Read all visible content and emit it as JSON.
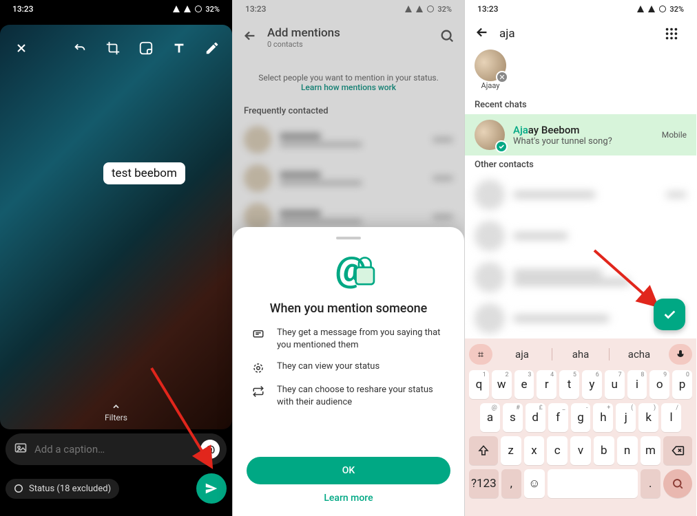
{
  "statusbar": {
    "time": "13:23",
    "battery": "32%"
  },
  "pane1": {
    "sticker_text": "test beebom",
    "filters_label": "Filters",
    "caption_placeholder": "Add a caption…",
    "audience": "Status (18 excluded)"
  },
  "pane2": {
    "title": "Add mentions",
    "subtitle": "0 contacts",
    "hint": "Select people you want to mention in your status.",
    "hint_link": "Learn how mentions work",
    "freq_label": "Frequently contacted",
    "sheet": {
      "heading": "When you mention someone",
      "b1": "They get a message from you saying that you mentioned them",
      "b2": "They can view your status",
      "b3": "They can choose to reshare your status with their audience",
      "ok": "OK",
      "learn": "Learn more"
    }
  },
  "pane3": {
    "search_value": "aja",
    "selected_name": "Ajaay",
    "recent_label": "Recent chats",
    "chat_name_match": "Aja",
    "chat_name_rest": "ay Beebom",
    "chat_sub": "What's your tunnel song?",
    "chat_meta": "Mobile",
    "other_label": "Other contacts",
    "suggestions": [
      "aja",
      "aha",
      "acha"
    ],
    "keyboard": {
      "r1": [
        [
          "q",
          "1"
        ],
        [
          "w",
          "2"
        ],
        [
          "e",
          "3"
        ],
        [
          "r",
          "4"
        ],
        [
          "t",
          "5"
        ],
        [
          "y",
          "6"
        ],
        [
          "u",
          "7"
        ],
        [
          "i",
          "8"
        ],
        [
          "o",
          "9"
        ],
        [
          "p",
          "0"
        ]
      ],
      "r2": [
        [
          "a",
          "@"
        ],
        [
          "s",
          "#"
        ],
        [
          "d",
          "£"
        ],
        [
          "f",
          "_"
        ],
        [
          "g",
          "-"
        ],
        [
          "h",
          "+"
        ],
        [
          "j",
          "("
        ],
        [
          "k",
          ")"
        ],
        [
          "l",
          "/"
        ]
      ],
      "r3": [
        "z",
        "x",
        "c",
        "v",
        "b",
        "n",
        "m"
      ],
      "num_label": "?123"
    }
  }
}
